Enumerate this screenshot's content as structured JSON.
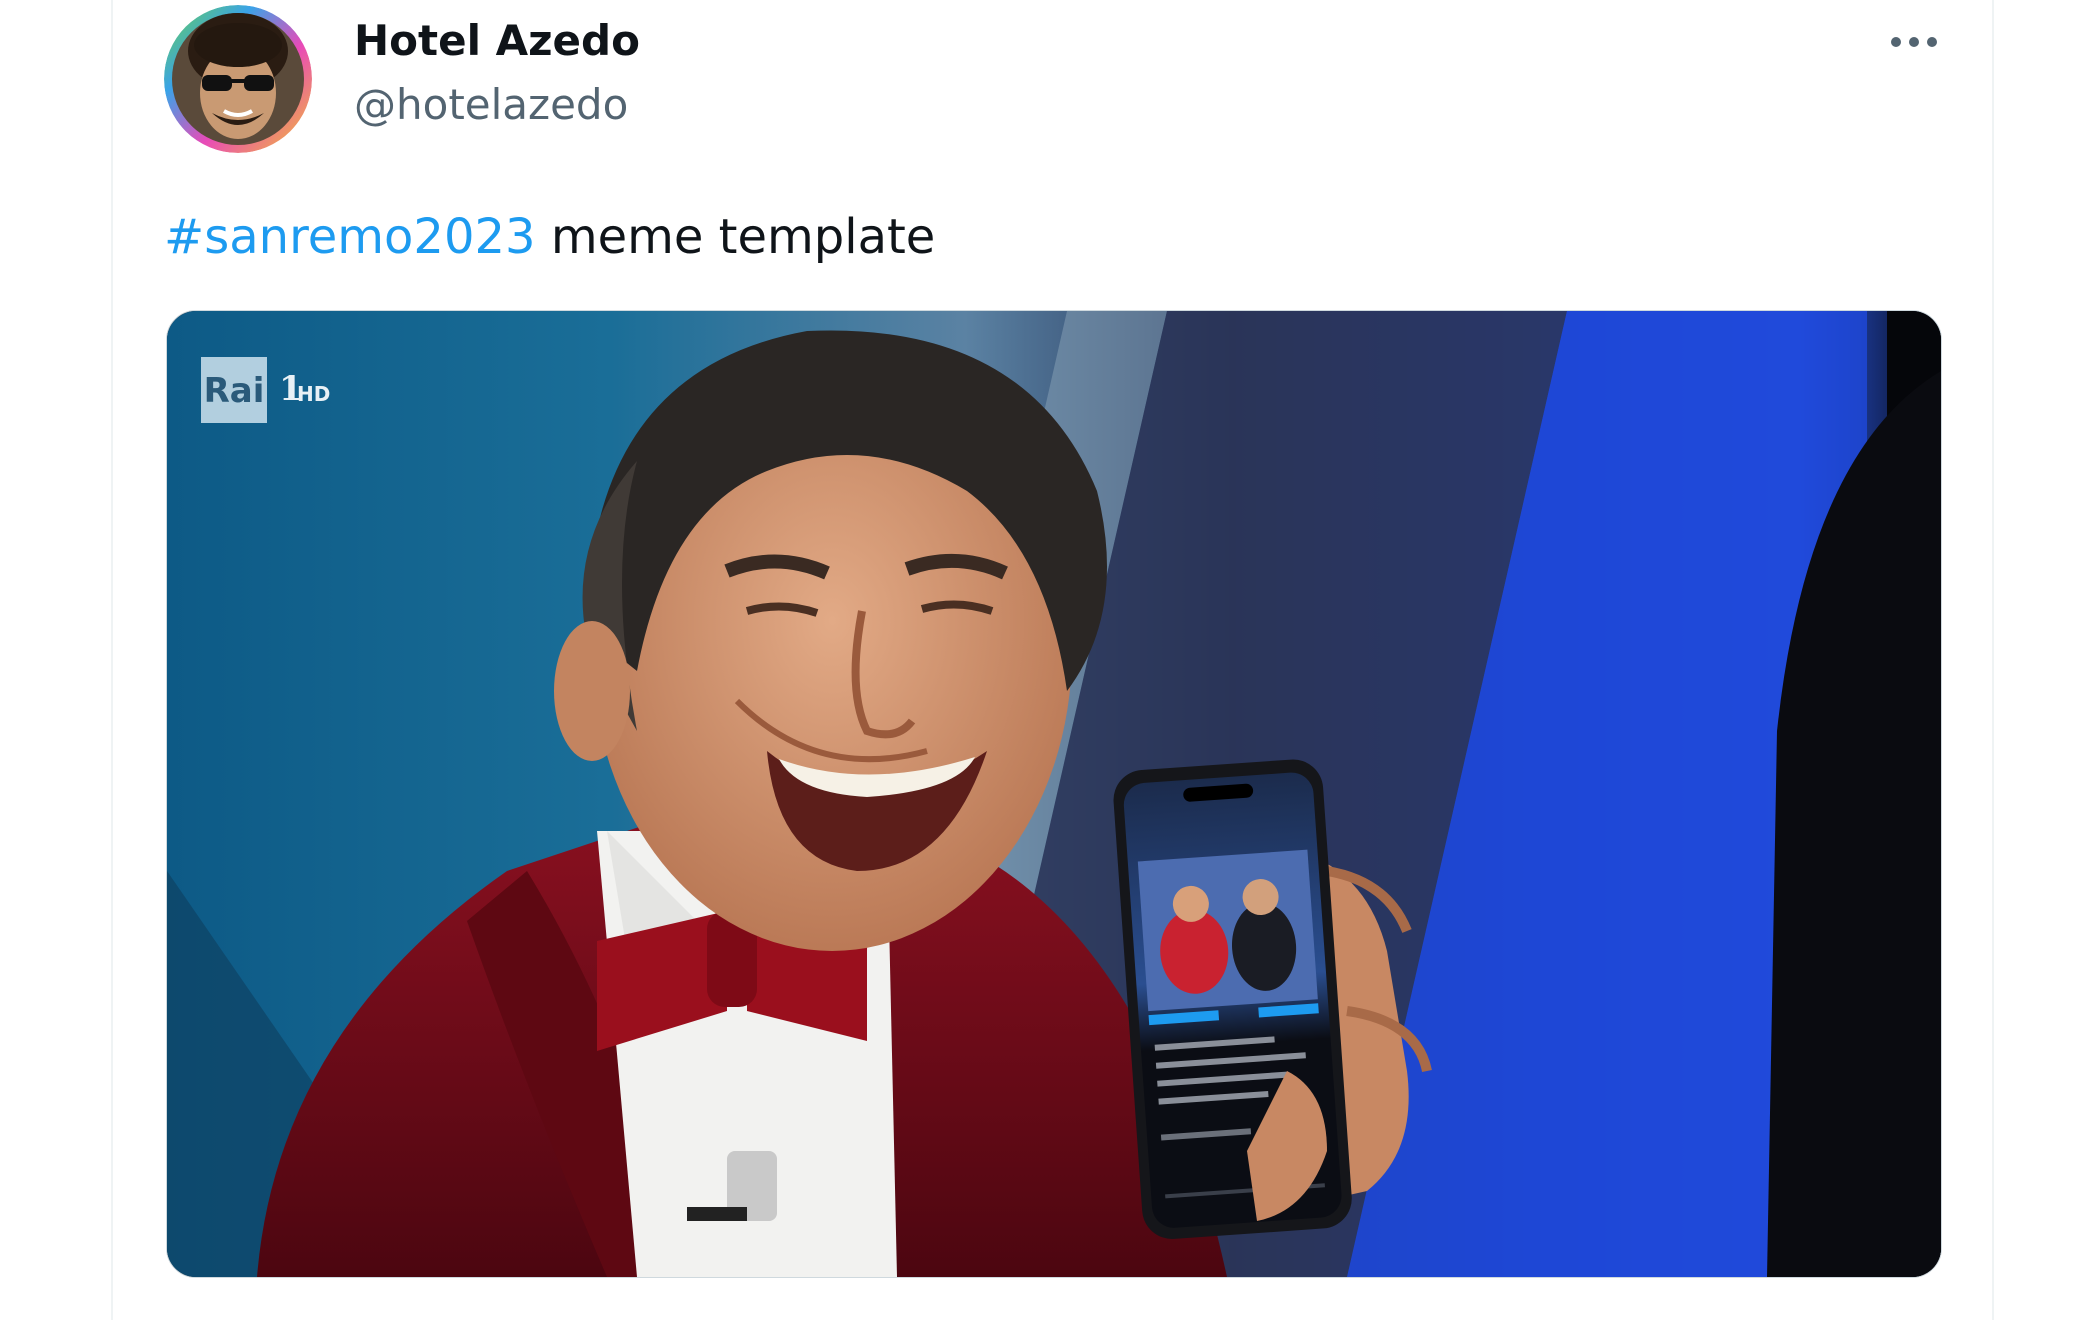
{
  "tweet": {
    "author": {
      "display_name": "Hotel Azedo",
      "handle": "@hotelazedo"
    },
    "text": {
      "hashtag": "#sanremo2023",
      "body": " meme template"
    },
    "media": {
      "watermark_rai": "Rai",
      "watermark_channel": "1",
      "watermark_hd": "HD"
    },
    "more_icon": "more-horizontal-icon"
  },
  "colors": {
    "hashtag": "#1d9bf0",
    "handle": "#536471",
    "name": "#0f1419",
    "card_border": "#eff3f4"
  }
}
